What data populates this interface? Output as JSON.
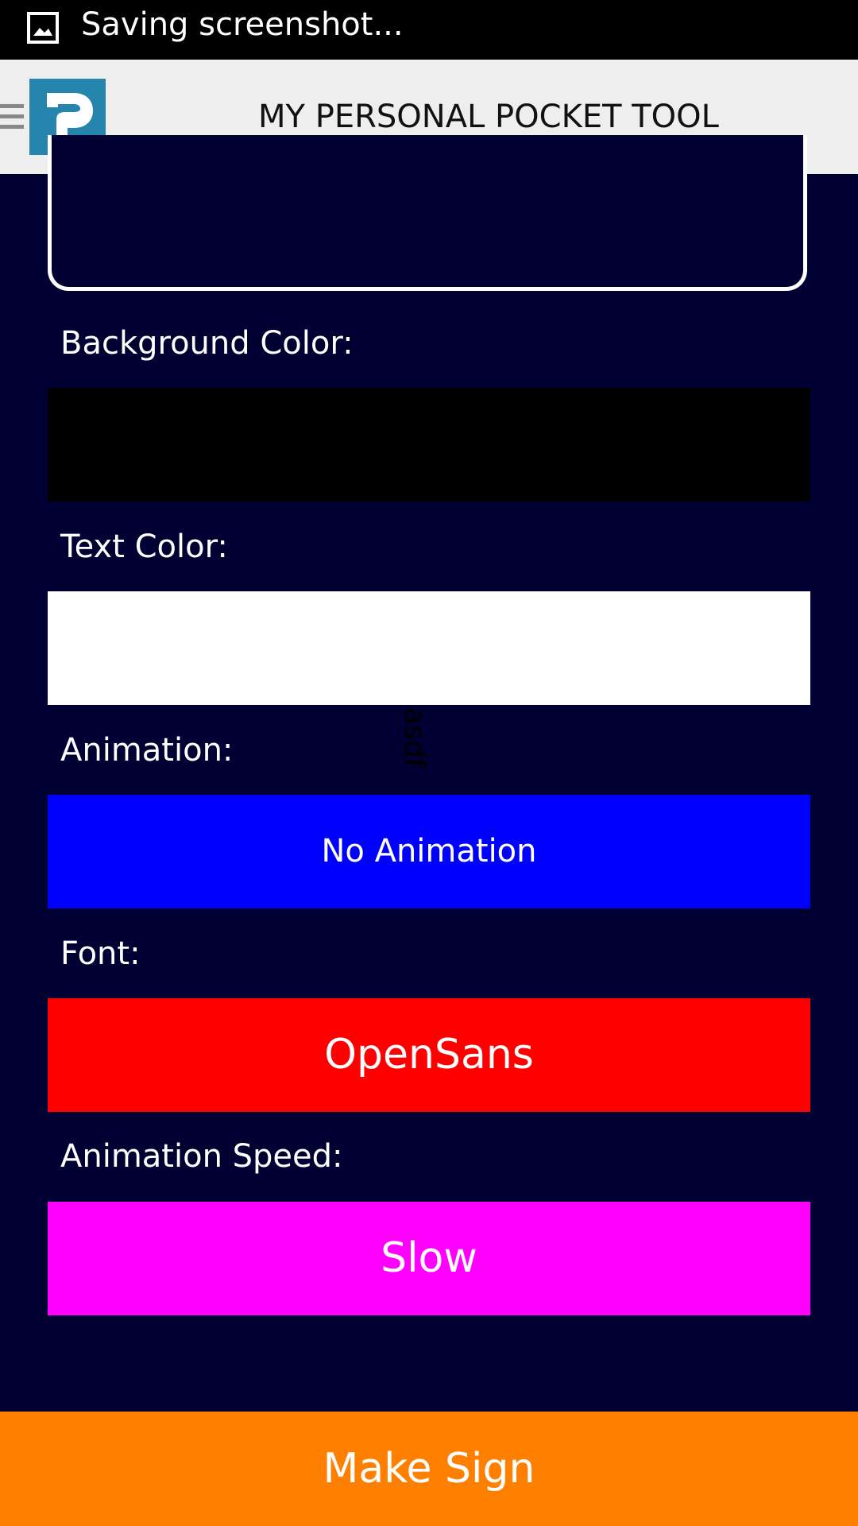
{
  "status_bar": {
    "text": "Saving screenshot...",
    "icon": "image-icon"
  },
  "app_bar": {
    "title": "MY PERSONAL POCKET TOOL",
    "logo_letter": "P",
    "drawer_icon": "hamburger-icon"
  },
  "form": {
    "background_color": {
      "label": "Background Color:",
      "value": "#000000"
    },
    "text_color": {
      "label": "Text Color:",
      "value": "#ffffff"
    },
    "animation": {
      "label": "Animation:",
      "value": "No Animation",
      "button_color": "#0000ff"
    },
    "font": {
      "label": "Font:",
      "value": "OpenSans",
      "button_color": "#ff0000"
    },
    "animation_speed": {
      "label": "Animation Speed:",
      "value": "Slow",
      "button_color": "#ff00ff"
    },
    "stray_preview_text": "asdf"
  },
  "actions": {
    "make_sign_label": "Make Sign",
    "make_sign_color": "#ff8000"
  },
  "colors": {
    "page_background": "#000033",
    "app_bar_background": "#eeeeee",
    "logo_background": "#2585ad"
  }
}
